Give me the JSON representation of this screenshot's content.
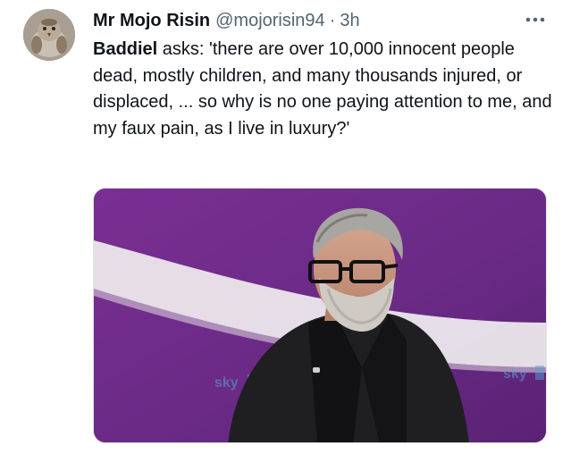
{
  "tweet": {
    "display_name": "Mr Mojo Risin",
    "handle": "@mojorisin94",
    "separator": "·",
    "time": "3h",
    "body_bold": "Baddiel",
    "body_rest": " asks: 'there are over 10,000 innocent people dead, mostly children, and many thousands injured, or displaced, ... so why is no one paying attention to me, and my faux pain, as I live in luxury?'",
    "avatar_icon": "sparrow-avatar",
    "more_icon": "more-horizontal-icon",
    "media": {
      "description_icon": "tv-interview-photo",
      "watermark_left": "sky",
      "watermark_right": "sky"
    }
  },
  "colors": {
    "text": "#0f1419",
    "secondary": "#536471",
    "purple_bg": "#6b2a86",
    "swoosh": "#e8e3e8"
  }
}
